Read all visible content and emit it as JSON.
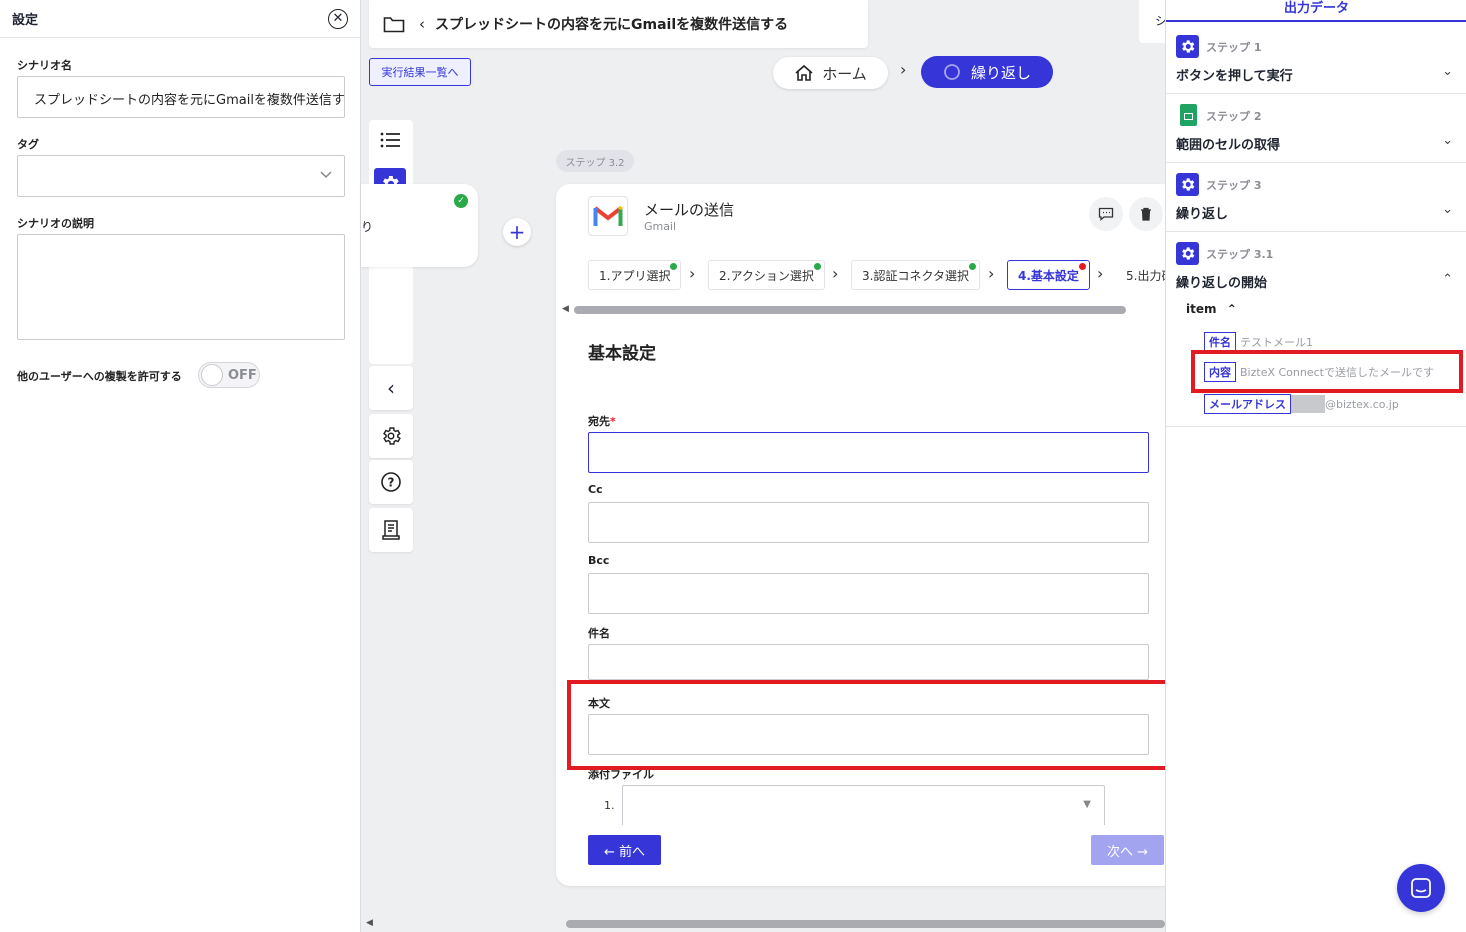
{
  "settings": {
    "title": "設定",
    "scenario_name_label": "シナリオ名",
    "scenario_name_value": "スプレッドシートの内容を元にGmailを複数件送信する",
    "tag_label": "タグ",
    "description_label": "シナリオの説明",
    "copy_permission_label": "他のユーザーへの複製を許可する",
    "toggle_state": "OFF"
  },
  "header": {
    "breadcrumb_title": "スプレッドシートの内容を元にGmailを複数件送信する",
    "results_link": "実行結果一覧へ",
    "nav_home": "ホーム",
    "nav_current": "繰り返し",
    "partial_right_tab": "シ"
  },
  "canvas": {
    "step_badge": "ステップ 3.2",
    "partial_node_text": "り"
  },
  "card": {
    "app_title": "メールの送信",
    "app_subtitle": "Gmail",
    "tabs": [
      {
        "label": "1.アプリ選択"
      },
      {
        "label": "2.アクション選択"
      },
      {
        "label": "3.認証コネクタ選択"
      },
      {
        "label": "4.基本設定"
      },
      {
        "label": "5.出力確"
      }
    ],
    "section_title": "基本設定",
    "fields": {
      "to_label": "宛先",
      "required_mark": "*",
      "cc_label": "Cc",
      "bcc_label": "Bcc",
      "subject_label": "件名",
      "body_label": "本文",
      "attachment_label": "添付ファイル",
      "attachment_index": "1."
    },
    "prev_button": "← 前へ",
    "next_button": "次へ →"
  },
  "output": {
    "header": "出力データ",
    "steps": [
      {
        "step": "ステップ 1",
        "name": "ボタンを押して実行"
      },
      {
        "step": "ステップ 2",
        "name": "範囲のセルの取得"
      },
      {
        "step": "ステップ 3",
        "name": "繰り返し"
      },
      {
        "step": "ステップ 3.1",
        "name": "繰り返しの開始"
      }
    ],
    "item_label": "item",
    "items": [
      {
        "key": "件名",
        "value": "テストメール1"
      },
      {
        "key": "内容",
        "value": "BizteX Connectで送信したメールです"
      },
      {
        "key": "メールアドレス",
        "value": "@biztex.co.jp"
      }
    ]
  },
  "colors": {
    "accent": "#3535d8",
    "highlight": "#e21b23",
    "success": "#2aa84a",
    "sheets_green": "#1ea362"
  }
}
